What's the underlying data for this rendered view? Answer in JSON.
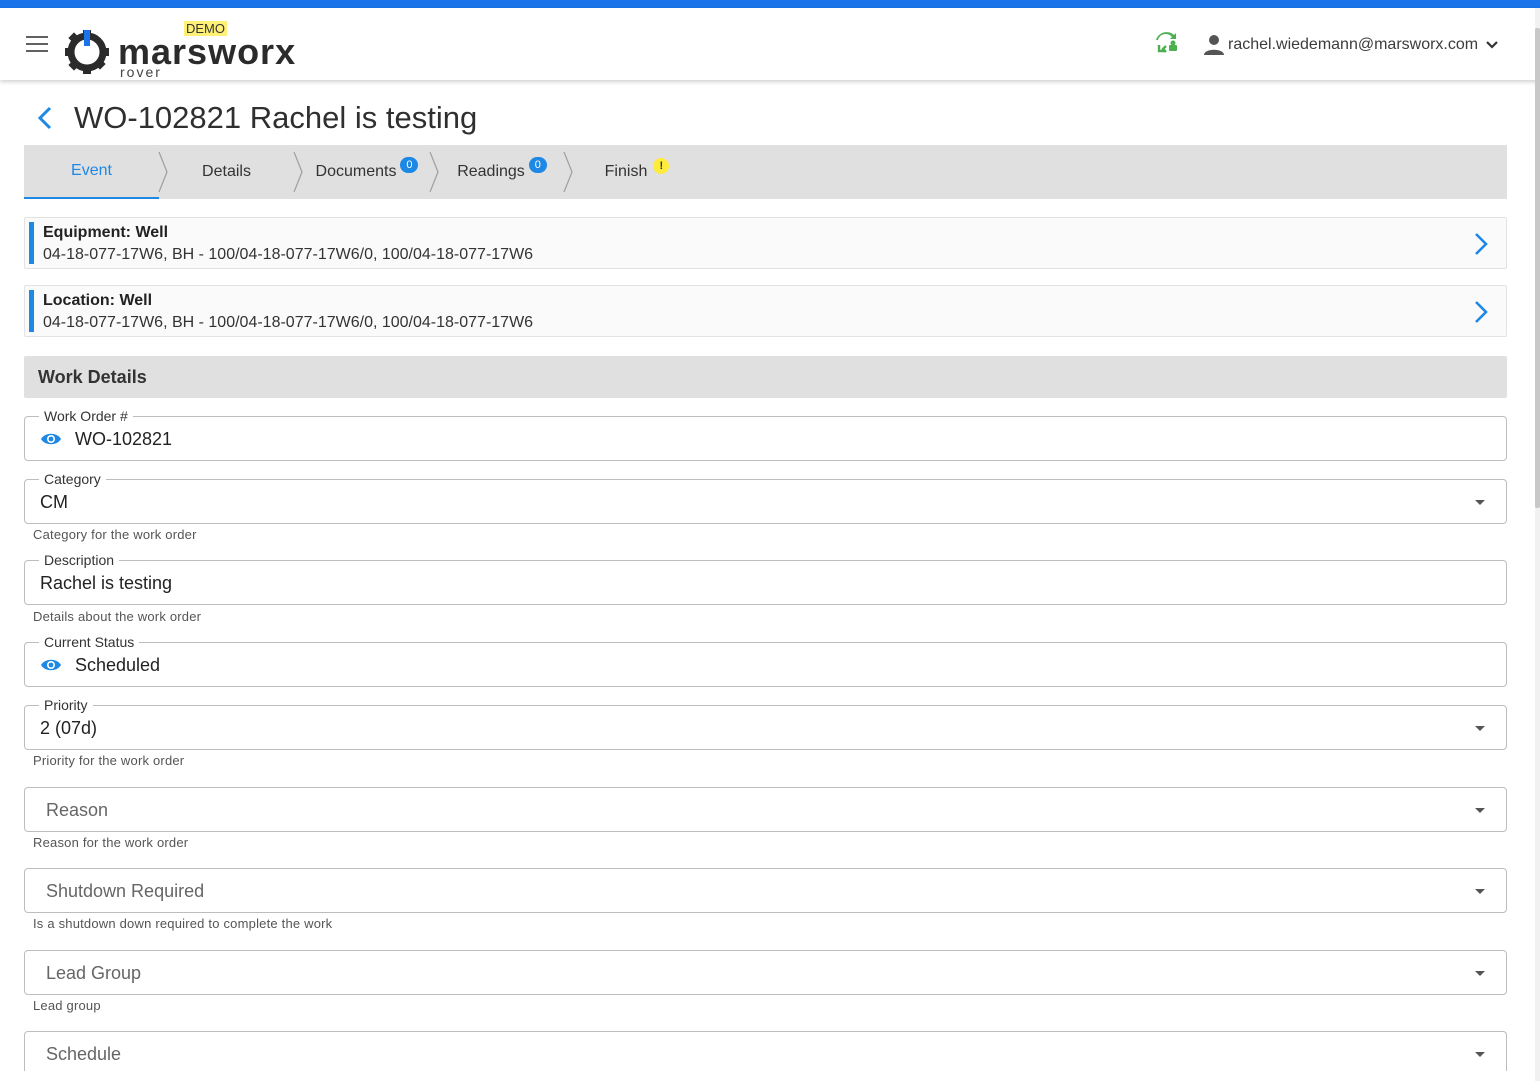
{
  "header": {
    "badge": "DEMO",
    "brand": "marsworx",
    "brand_sub": "rover",
    "user_email": "rachel.wiedemann@marsworx.com",
    "icons": [
      "menu-icon",
      "sync-icon",
      "user-icon",
      "chevron-down-icon"
    ],
    "accent_color": "#1a73e8",
    "sync_color": "#4caf50"
  },
  "page": {
    "title": "WO-102821 Rachel is testing"
  },
  "stepper": {
    "steps": [
      {
        "label": "Event",
        "active": true
      },
      {
        "label": "Details"
      },
      {
        "label": "Documents",
        "count": "0"
      },
      {
        "label": "Readings",
        "count": "0"
      },
      {
        "label": "Finish",
        "warning": "!"
      }
    ]
  },
  "cards": [
    {
      "heading": "Equipment: Well",
      "value": "04-18-077-17W6, BH - 100/04-18-077-17W6/0, 100/04-18-077-17W6"
    },
    {
      "heading": "Location: Well",
      "value": "04-18-077-17W6, BH - 100/04-18-077-17W6/0, 100/04-18-077-17W6"
    }
  ],
  "section": {
    "title": "Work Details"
  },
  "fields": {
    "work_order": {
      "label": "Work Order #",
      "value": "WO-102821"
    },
    "category": {
      "label": "Category",
      "value": "CM",
      "hint": "Category for the work order"
    },
    "description": {
      "label": "Description",
      "value": "Rachel is testing",
      "hint": "Details about the work order"
    },
    "current_status": {
      "label": "Current Status",
      "value": "Scheduled"
    },
    "priority": {
      "label": "Priority",
      "value": "2 (07d)",
      "hint": "Priority for the work order"
    },
    "reason": {
      "placeholder": "Reason",
      "hint": "Reason for the work order"
    },
    "shutdown": {
      "placeholder": "Shutdown Required",
      "hint": "Is a shutdown down required to complete the work"
    },
    "lead_group": {
      "placeholder": "Lead Group",
      "hint": "Lead group"
    },
    "schedule": {
      "placeholder": "Schedule"
    }
  }
}
